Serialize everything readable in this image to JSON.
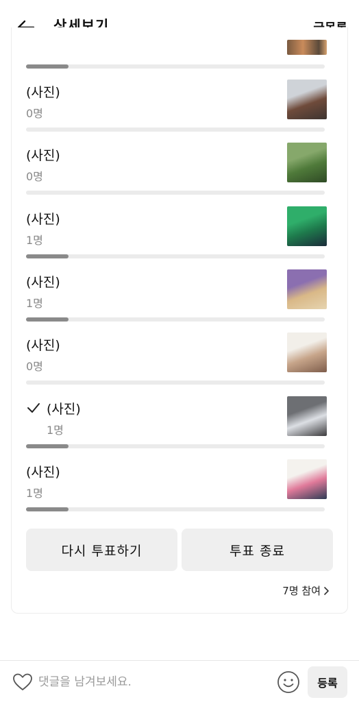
{
  "header": {
    "title": "상세보기",
    "list_link": "글목록"
  },
  "poll": {
    "partial_top": {
      "fill_ratio": 0.143
    },
    "options": [
      {
        "label": "(사진)",
        "count": "0명",
        "checked": false,
        "fill_ratio": 0.0,
        "thumb_colors": [
          "#6f4b3b",
          "#cfd3d8",
          "#3d3430"
        ]
      },
      {
        "label": "(사진)",
        "count": "0명",
        "checked": false,
        "fill_ratio": 0.0,
        "thumb_colors": [
          "#4f7a3a",
          "#86a86b",
          "#2f4a25"
        ]
      },
      {
        "label": "(사진)",
        "count": "1명",
        "checked": false,
        "fill_ratio": 0.143,
        "thumb_colors": [
          "#1e7a4c",
          "#2fae6a",
          "#1b2b3a"
        ]
      },
      {
        "label": "(사진)",
        "count": "1명",
        "checked": false,
        "fill_ratio": 0.143,
        "thumb_colors": [
          "#d9b887",
          "#8b6fb0",
          "#e6d4b0"
        ]
      },
      {
        "label": "(사진)",
        "count": "0명",
        "checked": false,
        "fill_ratio": 0.0,
        "thumb_colors": [
          "#c7a58a",
          "#f2efe9",
          "#7e5d4b"
        ]
      },
      {
        "label": "(사진)",
        "count": "1명",
        "checked": true,
        "fill_ratio": 0.143,
        "thumb_colors": [
          "#dcdfe4",
          "#6d6f73",
          "#3b3a3c"
        ]
      },
      {
        "label": "(사진)",
        "count": "1명",
        "checked": false,
        "fill_ratio": 0.143,
        "thumb_colors": [
          "#e07a9a",
          "#f4f2ee",
          "#2e3b55"
        ]
      }
    ],
    "revote_label": "다시 투표하기",
    "end_label": "투표 종료",
    "participants": "7명 참여"
  },
  "footer": {
    "comment_placeholder": "댓글을 남겨보세요.",
    "submit_label": "등록"
  },
  "icons": {
    "back": "back-arrow-icon",
    "check": "check-icon",
    "chevron": "chevron-right-icon",
    "heart": "heart-icon",
    "emoji": "emoji-icon"
  },
  "colors": {
    "bar_track": "#ebebeb",
    "bar_fill": "#8a8a8a",
    "button_bg": "#efefef"
  }
}
